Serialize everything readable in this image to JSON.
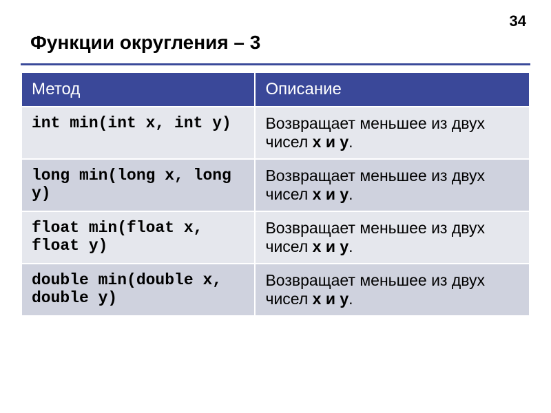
{
  "page_number": "34",
  "title": "Функции округления – 3",
  "header": {
    "method": "Метод",
    "description": "Описание"
  },
  "rows": [
    {
      "method": "int min(int x, int y)",
      "desc_prefix": "Возвращает меньшее из двух чисел ",
      "desc_vars": "x и y",
      "desc_suffix": "."
    },
    {
      "method": "long min(long x, long y)",
      "desc_prefix": "Возвращает меньшее из двух чисел ",
      "desc_vars": "x и y",
      "desc_suffix": "."
    },
    {
      "method": "float min(float x, float y)",
      "desc_prefix": "Возвращает меньшее из двух чисел ",
      "desc_vars": "x и y",
      "desc_suffix": "."
    },
    {
      "method": "double min(double x, double y)",
      "desc_prefix": "Возвращает меньшее из двух чисел ",
      "desc_vars": "x и y",
      "desc_suffix": "."
    }
  ],
  "chart_data": {
    "type": "table",
    "title": "Функции округления – 3",
    "columns": [
      "Метод",
      "Описание"
    ],
    "rows": [
      [
        "int min(int x, int y)",
        "Возвращает меньшее из двух чисел x и y."
      ],
      [
        "long min(long x, long y)",
        "Возвращает меньшее из двух чисел x и y."
      ],
      [
        "float min(float x, float y)",
        "Возвращает меньшее из двух чисел x и y."
      ],
      [
        "double min(double x, double y)",
        "Возвращает меньшее из двух чисел x и y."
      ]
    ]
  }
}
